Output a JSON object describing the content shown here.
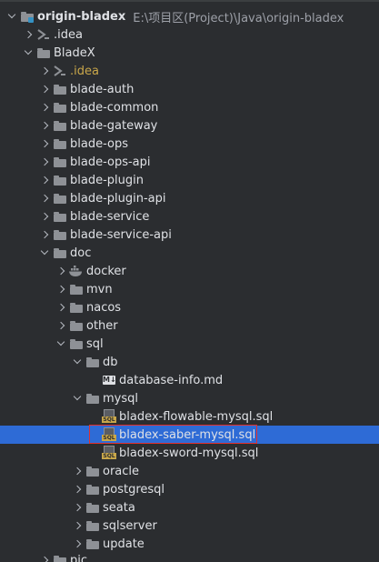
{
  "tree": [
    {
      "label": "origin-bladex",
      "path": "E:\\项目区(Project)\\Java\\origin-bladex",
      "icon": "module-folder-icon",
      "expanded": true,
      "bold": true
    },
    {
      "label": ".idea",
      "icon": "idea-icon",
      "expanded": false
    },
    {
      "label": "BladeX",
      "icon": "folder-icon",
      "expanded": true
    },
    {
      "label": ".idea",
      "icon": "idea-icon",
      "expanded": false
    },
    {
      "label": "blade-auth",
      "icon": "folder-icon",
      "expanded": false
    },
    {
      "label": "blade-common",
      "icon": "folder-icon",
      "expanded": false
    },
    {
      "label": "blade-gateway",
      "icon": "folder-icon",
      "expanded": false
    },
    {
      "label": "blade-ops",
      "icon": "folder-icon",
      "expanded": false
    },
    {
      "label": "blade-ops-api",
      "icon": "folder-icon",
      "expanded": false
    },
    {
      "label": "blade-plugin",
      "icon": "folder-icon",
      "expanded": false
    },
    {
      "label": "blade-plugin-api",
      "icon": "folder-icon",
      "expanded": false
    },
    {
      "label": "blade-service",
      "icon": "folder-icon",
      "expanded": false
    },
    {
      "label": "blade-service-api",
      "icon": "folder-icon",
      "expanded": false
    },
    {
      "label": "doc",
      "icon": "folder-icon",
      "expanded": true
    },
    {
      "label": "docker",
      "icon": "docker-icon",
      "expanded": false
    },
    {
      "label": "mvn",
      "icon": "folder-icon",
      "expanded": false
    },
    {
      "label": "nacos",
      "icon": "folder-icon",
      "expanded": false
    },
    {
      "label": "other",
      "icon": "folder-icon",
      "expanded": false
    },
    {
      "label": "sql",
      "icon": "folder-icon",
      "expanded": true
    },
    {
      "label": "db",
      "icon": "folder-icon",
      "expanded": true
    },
    {
      "label": "database-info.md",
      "icon": "markdown-file-icon"
    },
    {
      "label": "mysql",
      "icon": "folder-icon",
      "expanded": true
    },
    {
      "label": "bladex-flowable-mysql.sql",
      "icon": "sql-file-icon"
    },
    {
      "label": "bladex-saber-mysql.sql",
      "icon": "sql-file-icon",
      "selected": true
    },
    {
      "label": "bladex-sword-mysql.sql",
      "icon": "sql-file-icon"
    },
    {
      "label": "oracle",
      "icon": "folder-icon",
      "expanded": false
    },
    {
      "label": "postgresql",
      "icon": "folder-icon",
      "expanded": false
    },
    {
      "label": "seata",
      "icon": "folder-icon",
      "expanded": false
    },
    {
      "label": "sqlserver",
      "icon": "folder-icon",
      "expanded": false
    },
    {
      "label": "update",
      "icon": "folder-icon",
      "expanded": false
    },
    {
      "label": "pic",
      "icon": "folder-icon",
      "expanded": false
    }
  ],
  "colors": {
    "background": "#2b2d30",
    "selection": "#2e6bd6",
    "highlight_border": "#e0312e",
    "idea_text": "#c9a74a"
  }
}
